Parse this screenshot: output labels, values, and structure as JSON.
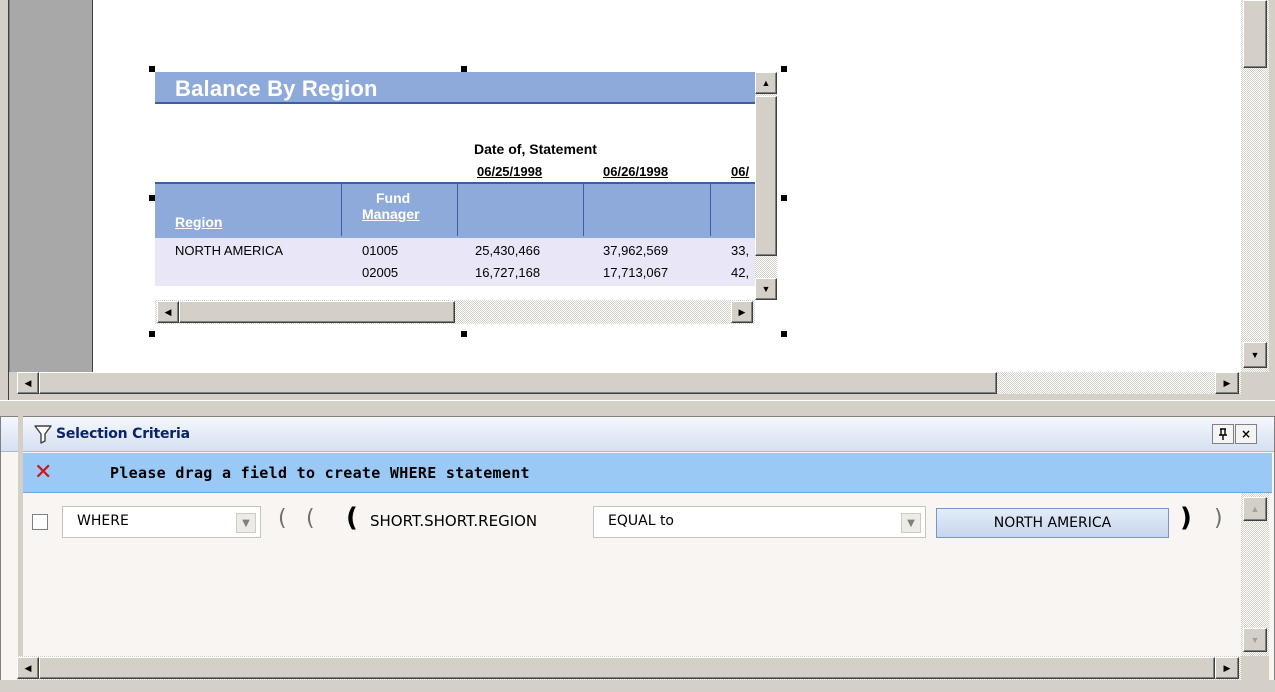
{
  "report": {
    "title": "Balance By Region",
    "column_group_label": "Date of, Statement",
    "date_headers": [
      "06/25/1998",
      "06/26/1998",
      "06/"
    ],
    "row_headers": {
      "region": "Region",
      "fund_manager_line1": "Fund",
      "fund_manager_line2": "Manager"
    },
    "rows": [
      {
        "region": "NORTH AMERICA",
        "fund_manager": "01005",
        "values": [
          "25,430,466",
          "37,962,569",
          "33,"
        ]
      },
      {
        "region": "",
        "fund_manager": "02005",
        "values": [
          "16,727,168",
          "17,713,067",
          "42,"
        ]
      }
    ]
  },
  "panel": {
    "title": "Selection Criteria",
    "pin_label": "A",
    "close_label": "×",
    "hint_icon": "✕",
    "hint_text": "Please drag a field to create WHERE statement",
    "criteria": {
      "clause": "WHERE",
      "open_paren": "(",
      "field": "SHORT.SHORT.REGION",
      "operator": "EQUAL to",
      "value": "NORTH AMERICA",
      "close_paren": ")"
    }
  },
  "icons": {
    "scroll_up": "▲",
    "scroll_down": "▼",
    "scroll_left": "◀",
    "scroll_right": "▶",
    "dropdown": "▼",
    "filter": "filter-icon",
    "pin": "pin-icon"
  },
  "colors": {
    "report_header": "#8eaadb",
    "report_rule": "#3e5ea3",
    "data_band": "#e8e6f7",
    "hint_bar": "#9ac9f6",
    "panel_title": "#0a246a",
    "error_red": "#d11414"
  }
}
